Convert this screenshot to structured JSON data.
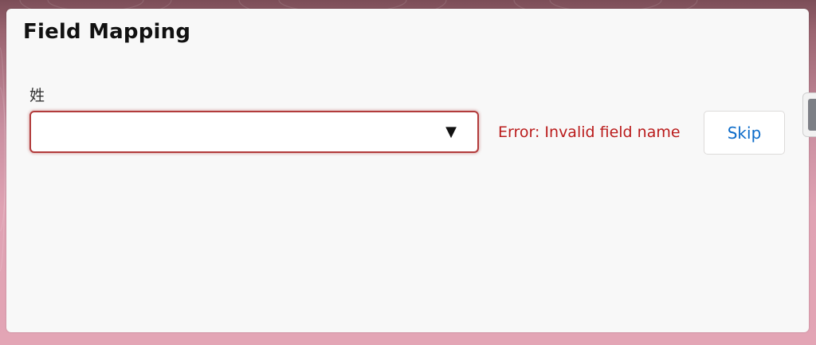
{
  "panel": {
    "title": "Field Mapping"
  },
  "field": {
    "label": "姓",
    "selected_value": "",
    "caret_glyph": "▼"
  },
  "error": {
    "message": "Error: Invalid field name"
  },
  "actions": {
    "skip_label": "Skip"
  },
  "colors": {
    "error": "#ba1b1b",
    "link": "#0b6bc9",
    "panel_bg": "#f8f8f8"
  }
}
